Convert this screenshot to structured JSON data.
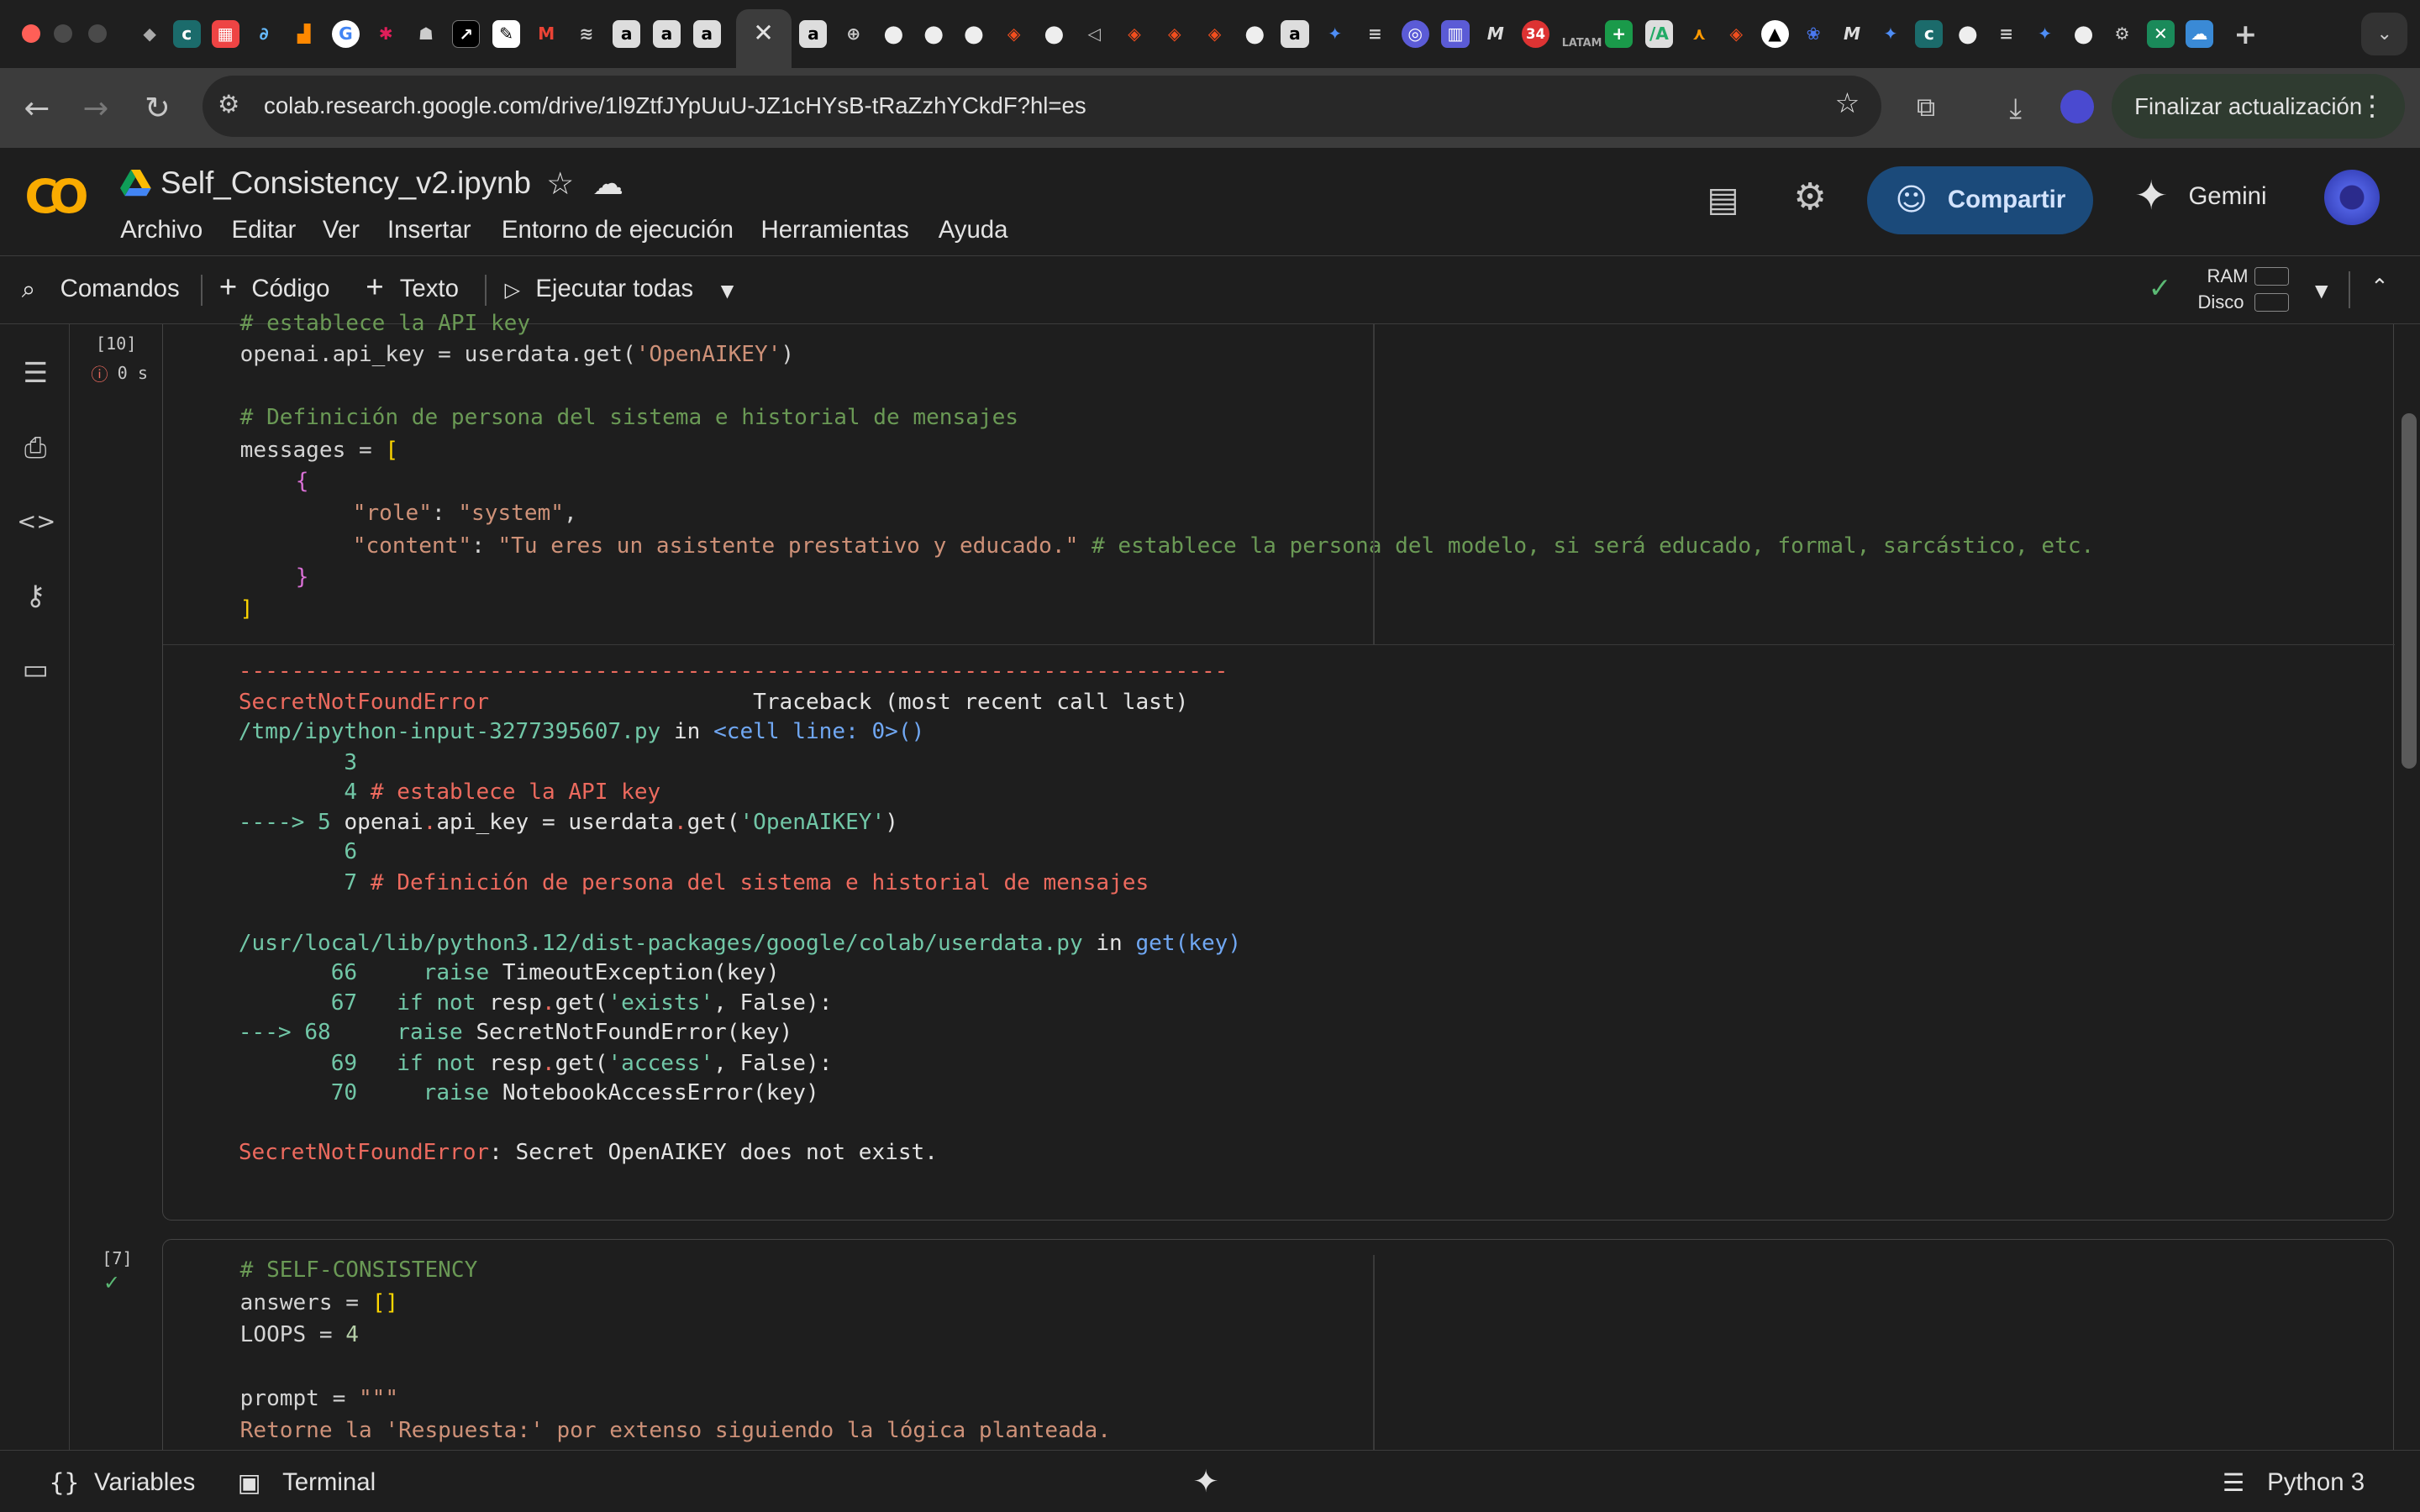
{
  "browser": {
    "url": "colab.research.google.com/drive/1l9ZtfJYpUuU-JZ1cHYsB-tRaZzhYCkdF?hl=es",
    "update_label": "Finalizar actualización",
    "tab_badge": "34",
    "tab_badge_label": "LATAM"
  },
  "header": {
    "logo": "CO",
    "file_name": "Self_Consistency_v2.ipynb",
    "menu": [
      "Archivo",
      "Editar",
      "Ver",
      "Insertar",
      "Entorno de ejecución",
      "Herramientas",
      "Ayuda"
    ],
    "share_label": "Compartir",
    "gemini_label": "Gemini"
  },
  "toolbar": {
    "commands_label": "Comandos",
    "code_label": "Código",
    "text_label": "Texto",
    "run_all_label": "Ejecutar todas",
    "ram_label": "RAM",
    "disk_label": "Disco"
  },
  "cell1": {
    "exec_count": "[10]",
    "exec_time": "0 s",
    "partial_top": "# establece la API key",
    "code_line1_a": "openai.api_key = userdata.get(",
    "code_line1_b": "'OpenAIKEY'",
    "code_line1_c": ")",
    "code_comment": "# Definición de persona del sistema e historial de mensajes",
    "messages_a": "messages = ",
    "open_bracket": "[",
    "open_brace": "{",
    "role_key": "\"role\"",
    "role_val": "\"system\"",
    "content_key": "\"content\"",
    "content_val": "\"Tu eres un asistente prestativo y educado.\"",
    "content_comment": "# establece la persona del modelo, si será educado, formal, sarcástico, etc.",
    "close_brace": "}",
    "close_bracket": "]"
  },
  "output": {
    "dashes": "---------------------------------------------------------------------------",
    "error_name": "SecretNotFoundError",
    "traceback_label": "Traceback (most recent call last)",
    "file1": "/tmp/ipython-input-3277395607.py",
    "in_word": " in ",
    "cell_loc": "<cell line: 0>()",
    "l3": "        3",
    "l4_num": "        4 ",
    "l4_code": "# establece la API key",
    "l5_arrow": "----> 5 ",
    "l5_a": "openai",
    "l5_b": ".",
    "l5_c": "api_key = userdata",
    "l5_d": ".",
    "l5_e": "get(",
    "l5_f": "'OpenAIKEY'",
    "l5_g": ")",
    "l6": "        6",
    "l7_num": "        7 ",
    "l7_code": "# Definición de persona del sistema e historial de mensajes",
    "file2": "/usr/local/lib/python3.12/dist-packages/google/colab/userdata.py",
    "func": "get(key)",
    "l66_num": "       66 ",
    "l66_kw": "    raise ",
    "l66_code": "TimeoutException(key)",
    "l67_num": "       67 ",
    "l67_kw": "  if not ",
    "l67_a": "resp",
    "l67_b": ".",
    "l67_c": "get(",
    "l67_d": "'exists'",
    "l67_e": ", False):",
    "l68_arrow": "---> 68 ",
    "l68_kw": "    raise ",
    "l68_code": "SecretNotFoundError(key)",
    "l69_num": "       69 ",
    "l69_kw": "  if not ",
    "l69_a": "resp",
    "l69_b": ".",
    "l69_c": "get(",
    "l69_d": "'access'",
    "l69_e": ", False):",
    "l70_num": "       70 ",
    "l70_kw": "    raise ",
    "l70_code": "NotebookAccessError(key)",
    "final_name": "SecretNotFoundError",
    "final_msg": ": Secret OpenAIKEY does not exist."
  },
  "cell2": {
    "exec_count": "[7]",
    "c_comment": "# SELF-CONSISTENCY",
    "answers_a": "answers = ",
    "answers_b": "[]",
    "loops_a": "LOOPS = ",
    "loops_b": "4",
    "prompt_a": "prompt = ",
    "prompt_b": "\"\"\"",
    "prompt_line": "Retorne la 'Respuesta:' por extenso siguiendo la lógica planteada."
  },
  "statusbar": {
    "variables_label": "Variables",
    "terminal_label": "Terminal",
    "runtime_label": "Python 3"
  },
  "colors": {
    "accent_share": "#1b4a7a",
    "error_red": "#ec6a5e",
    "path_green": "#71c7a7"
  }
}
